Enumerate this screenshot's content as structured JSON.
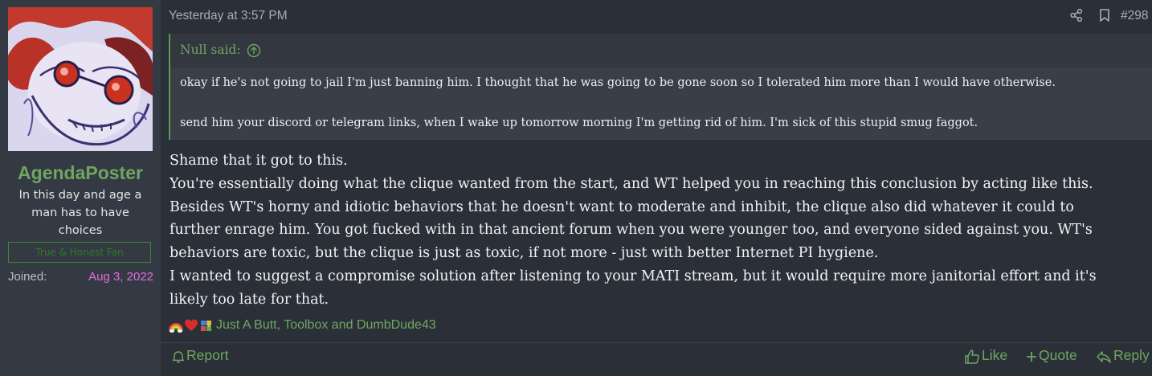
{
  "author": {
    "username": "AgendaPoster",
    "title": "In this day and age a man has to have choices",
    "banner": "True & Honest Fan",
    "joined_label": "Joined:",
    "joined_date": "Aug 3, 2022",
    "avatar_icon": "avatar-image"
  },
  "post": {
    "date": "Yesterday at 3:57 PM",
    "number": "#298",
    "quote": {
      "attribution": "Null said:",
      "lines": [
        "okay if he's not going to jail I'm just banning him. I thought that he was going to be gone soon so I tolerated him more than I would have otherwise.",
        "send him your discord or telegram links, when I wake up tomorrow morning I'm getting rid of him. I'm sick of this stupid smug faggot."
      ]
    },
    "message_lines": [
      "Shame that it got to this.",
      "You're essentially doing what the clique wanted from the start, and WT helped you in reaching this conclusion by acting like this.",
      "Besides WT's horny and idiotic behaviors that he doesn't want to moderate and inhibit, the clique also did whatever it could to",
      "further enrage him. You got fucked with in that ancient forum when you were younger too, and everyone sided against you. WT's",
      "behaviors are toxic, but the clique is just as toxic, if not more - just with better Internet PI hygiene.",
      "I wanted to suggest a compromise solution after listening to your MATI stream, but it would require more janitorial effort and it's",
      "likely too late for that."
    ],
    "reactions": {
      "icons": [
        "rainbow-icon",
        "heart-icon",
        "puzzle-icon"
      ],
      "names": "Just A Butt, Toolbox and DumbDude43"
    }
  },
  "footer": {
    "report": "Report",
    "like": "Like",
    "quote": "Quote",
    "reply": "Reply"
  },
  "colors": {
    "accent_green": "#6fa65f",
    "joined_date": "#e36be3",
    "background": "#2b3038",
    "sidebar": "#343a43"
  }
}
